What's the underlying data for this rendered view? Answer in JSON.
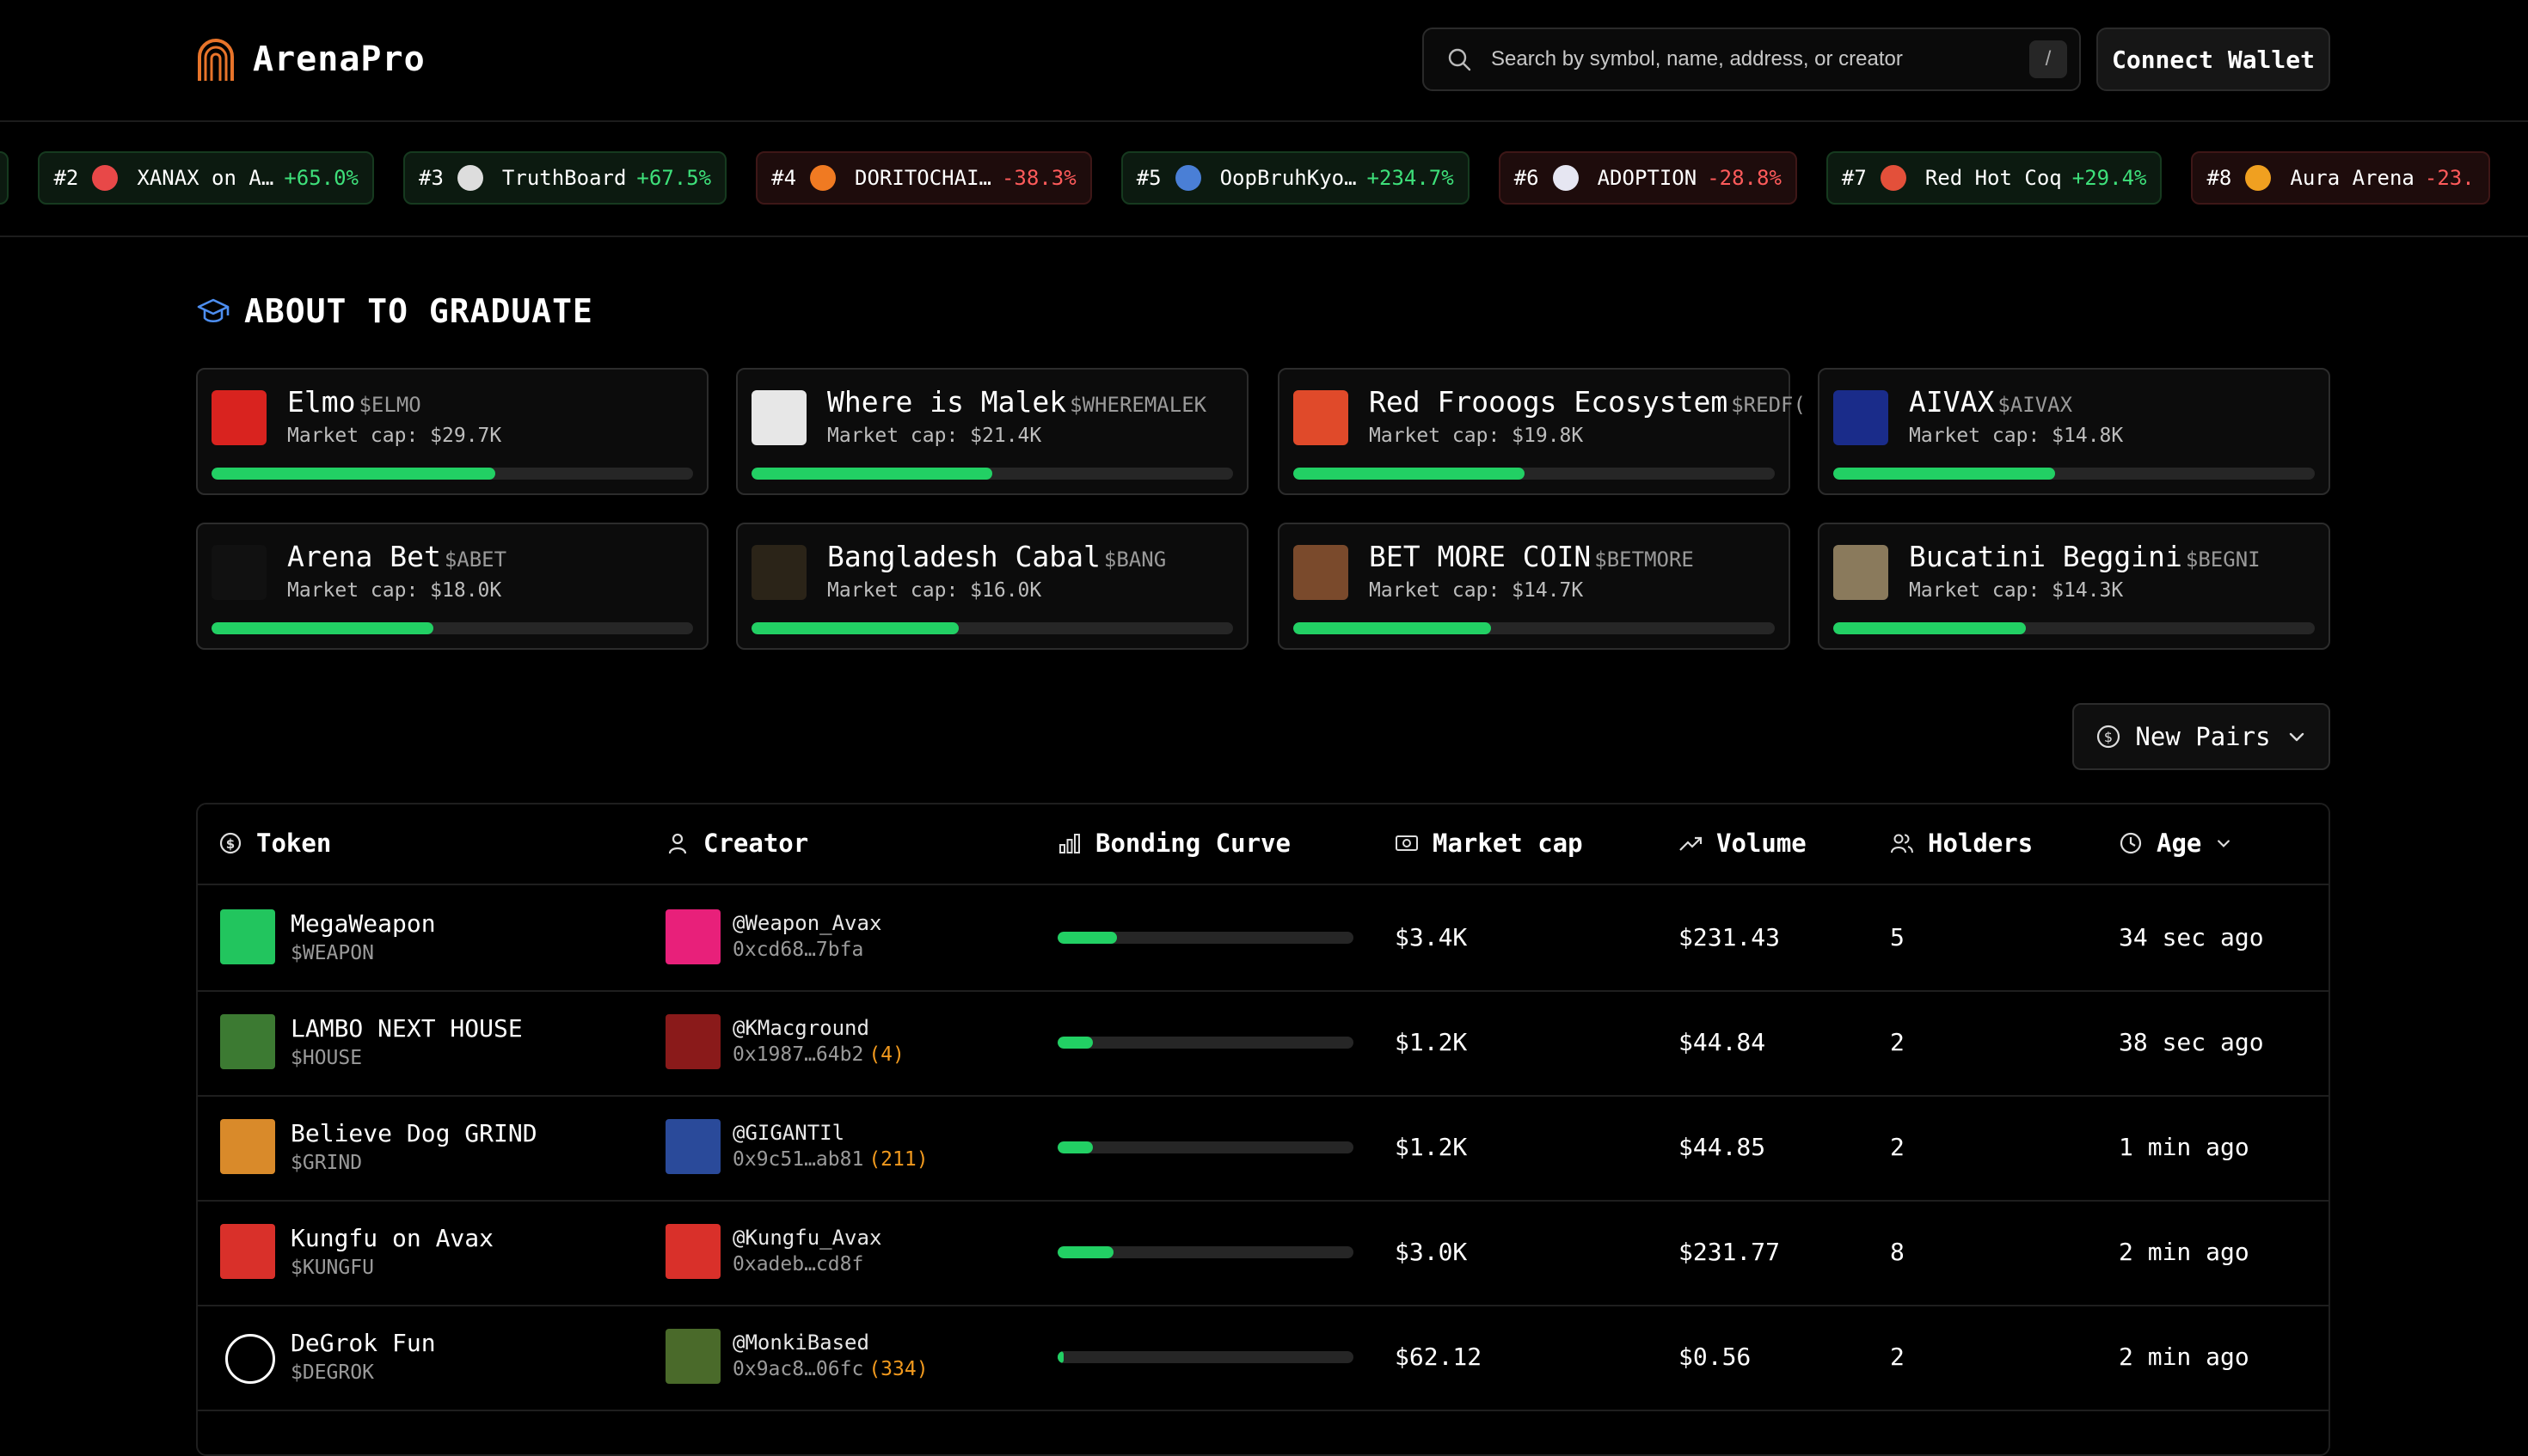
{
  "header": {
    "brand": "ArenaPro",
    "search_placeholder": "Search by symbol, name, address, or creator",
    "search_shortcut": "/",
    "connect_label": "Connect Wallet"
  },
  "ticker": [
    {
      "rank": "",
      "name": "",
      "change": "%",
      "dir": "up",
      "color": "#2a2a2a"
    },
    {
      "rank": "#2",
      "name": "XANAX on A…",
      "change": "+65.0%",
      "dir": "up",
      "color": "#e84848"
    },
    {
      "rank": "#3",
      "name": "TruthBoard",
      "change": "+67.5%",
      "dir": "up",
      "color": "#dddddd"
    },
    {
      "rank": "#4",
      "name": "DORITOCHAI…",
      "change": "-38.3%",
      "dir": "down",
      "color": "#f07a22"
    },
    {
      "rank": "#5",
      "name": "OopBruhKyo…",
      "change": "+234.7%",
      "dir": "up",
      "color": "#4a7fd6"
    },
    {
      "rank": "#6",
      "name": "ADOPTION",
      "change": "-28.8%",
      "dir": "down",
      "color": "#e6e6f2"
    },
    {
      "rank": "#7",
      "name": "Red Hot Coq",
      "change": "+29.4%",
      "dir": "up",
      "color": "#e3503a"
    },
    {
      "rank": "#8",
      "name": "Aura Arena",
      "change": "-23.",
      "dir": "down",
      "color": "#f0a020"
    }
  ],
  "graduate": {
    "title": "ABOUT TO GRADUATE",
    "cards": [
      {
        "name": "Elmo",
        "symbol": "$ELMO",
        "mcap": "Market cap: $29.7K",
        "progress": 0.59,
        "color": "#d9231f"
      },
      {
        "name": "Where is Malek",
        "symbol": "$WHEREMALEK",
        "mcap": "Market cap: $21.4K",
        "progress": 0.5,
        "color": "#e7e7e7"
      },
      {
        "name": "Red Frooogs Ecosystem",
        "symbol": "$REDF(",
        "mcap": "Market cap: $19.8K",
        "progress": 0.48,
        "color": "#e04a2a"
      },
      {
        "name": "AIVAX",
        "symbol": "$AIVAX",
        "mcap": "Market cap: $14.8K",
        "progress": 0.46,
        "color": "#1a2c8a"
      },
      {
        "name": "Arena Bet",
        "symbol": "$ABET",
        "mcap": "Market cap: $18.0K",
        "progress": 0.46,
        "color": "#111111"
      },
      {
        "name": "Bangladesh Cabal",
        "symbol": "$BANG",
        "mcap": "Market cap: $16.0K",
        "progress": 0.43,
        "color": "#2b2418"
      },
      {
        "name": "BET MORE COIN",
        "symbol": "$BETMORE",
        "mcap": "Market cap: $14.7K",
        "progress": 0.41,
        "color": "#7a4a2c"
      },
      {
        "name": "Bucatini Beggini",
        "symbol": "$BEGNI",
        "mcap": "Market cap: $14.3K",
        "progress": 0.4,
        "color": "#8a7a5c"
      }
    ]
  },
  "filter": {
    "label": "New Pairs"
  },
  "table": {
    "headers": {
      "token": "Token",
      "creator": "Creator",
      "bonding": "Bonding Curve",
      "mcap": "Market cap",
      "volume": "Volume",
      "holders": "Holders",
      "age": "Age"
    },
    "rows": [
      {
        "name": "MegaWeapon",
        "symbol": "$WEAPON",
        "creator": "@Weapon_Avax",
        "address": "0xcd68…7bfa",
        "count": "",
        "bonding": 0.2,
        "mcap": "$3.4K",
        "volume": "$231.43",
        "holders": "5",
        "age": "34 sec ago",
        "tok_color": "#22c55e",
        "cr_color": "#e8207a"
      },
      {
        "name": "LAMBO NEXT HOUSE",
        "symbol": "$HOUSE",
        "creator": "@KMacground",
        "address": "0x1987…64b2",
        "count": "(4)",
        "bonding": 0.12,
        "mcap": "$1.2K",
        "volume": "$44.84",
        "holders": "2",
        "age": "38 sec ago",
        "tok_color": "#3c7a32",
        "cr_color": "#8a1a1a"
      },
      {
        "name": "Believe Dog GRIND",
        "symbol": "$GRIND",
        "creator": "@GIGANTIl",
        "address": "0x9c51…ab81",
        "count": "(211)",
        "bonding": 0.12,
        "mcap": "$1.2K",
        "volume": "$44.85",
        "holders": "2",
        "age": "1 min ago",
        "tok_color": "#d98a2a",
        "cr_color": "#2a4a9a"
      },
      {
        "name": "Kungfu on Avax",
        "symbol": "$KUNGFU",
        "creator": "@Kungfu_Avax",
        "address": "0xadeb…cd8f",
        "count": "",
        "bonding": 0.19,
        "mcap": "$3.0K",
        "volume": "$231.77",
        "holders": "8",
        "age": "2 min ago",
        "tok_color": "#d9302a",
        "cr_color": "#d9302a"
      },
      {
        "name": "DeGrok Fun",
        "symbol": "$DEGROK",
        "creator": "@MonkiBased",
        "address": "0x9ac8…06fc",
        "count": "(334)",
        "bonding": 0.02,
        "mcap": "$62.12",
        "volume": "$0.56",
        "holders": "2",
        "age": "2 min ago",
        "tok_color": "#000000",
        "cr_color": "#4a6a2a"
      }
    ]
  }
}
